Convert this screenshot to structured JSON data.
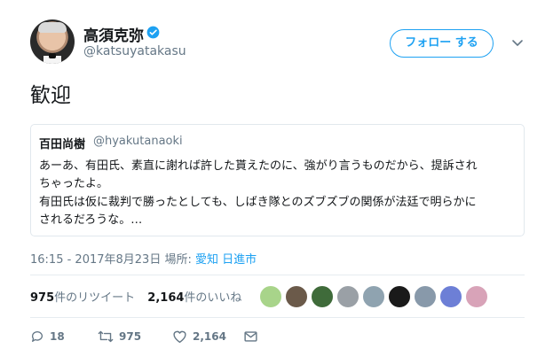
{
  "user": {
    "name": "高須克弥",
    "handle": "@katsuyatakasu",
    "verified": true
  },
  "follow_button": {
    "label": "フォロー する"
  },
  "tweet": {
    "text": "歓迎"
  },
  "quoted": {
    "name": "百田尚樹",
    "handle": "@hyakutanaoki",
    "lines": [
      "あーあ、有田氏、素直に謝れば許した貰えたのに、強がり言うものだから、提訴され",
      "ちゃったよ。",
      "有田氏は仮に裁判で勝ったとしても、しばき隊とのズブズブの関係が法廷で明らかに",
      "されるだろうな。…"
    ]
  },
  "meta": {
    "timestamp": "16:15 - 2017年8月23日",
    "place_label": "場所:",
    "place": "愛知 日進市"
  },
  "stats": {
    "retweets_count": "975",
    "retweets_label": "件のリツイート",
    "likes_count": "2,164",
    "likes_label": "件のいいね"
  },
  "liker_avatar_colors": [
    "#a8d48a",
    "#6b5a4a",
    "#3f6b3a",
    "#9aa0a6",
    "#8fa3b0",
    "#1a1a1a",
    "#8899aa",
    "#6d7fd6",
    "#d8a3b8"
  ],
  "actions": {
    "replies": "18",
    "retweets": "975",
    "likes": "2,164"
  },
  "colors": {
    "accent": "#1da1f2",
    "secondary_text": "#657786",
    "primary_text": "#14171a"
  }
}
